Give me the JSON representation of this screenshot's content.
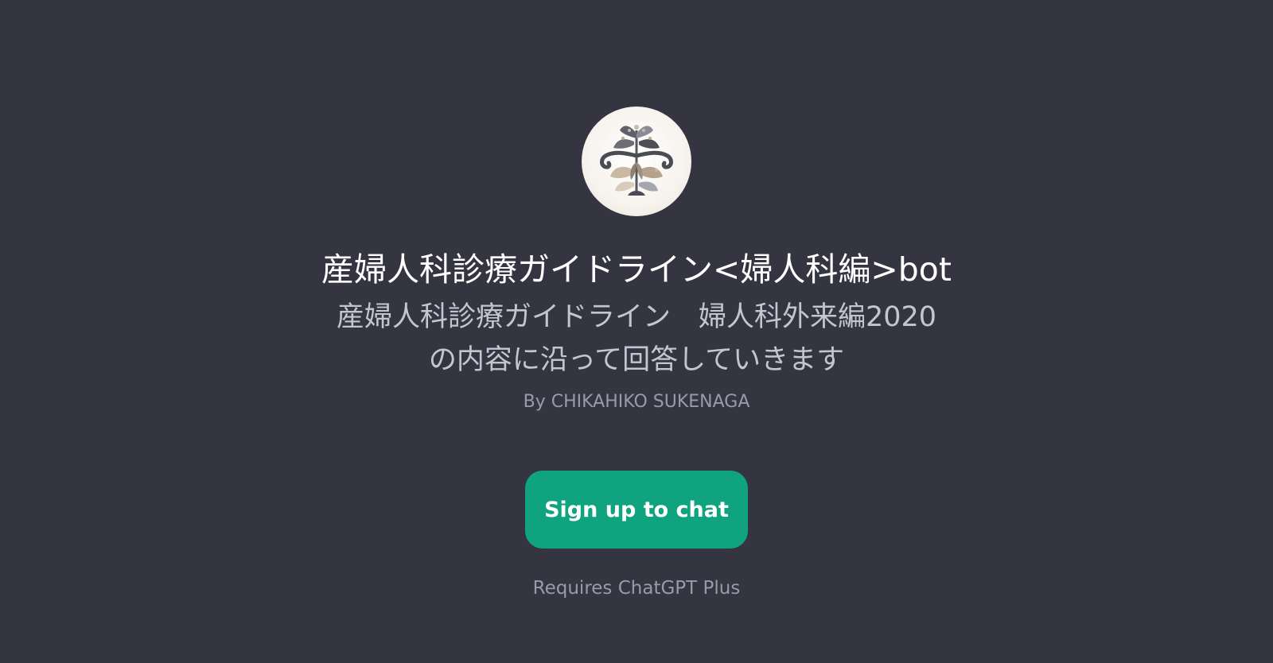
{
  "gpt": {
    "avatar_icon": "botanical-leaf-logo-icon",
    "title": "産婦人科診療ガイドライン<婦人科編>bot",
    "description": "産婦人科診療ガイドライン　婦人科外来編2020\nの内容に沿って回答していきます",
    "author": "By CHIKAHIKO SUKENAGA"
  },
  "actions": {
    "signup_label": "Sign up to chat",
    "requirement_note": "Requires ChatGPT Plus"
  },
  "colors": {
    "background": "#343541",
    "accent": "#10a37f",
    "title": "#ffffff",
    "description": "#c5c5d2",
    "muted": "#9a9aa8"
  }
}
